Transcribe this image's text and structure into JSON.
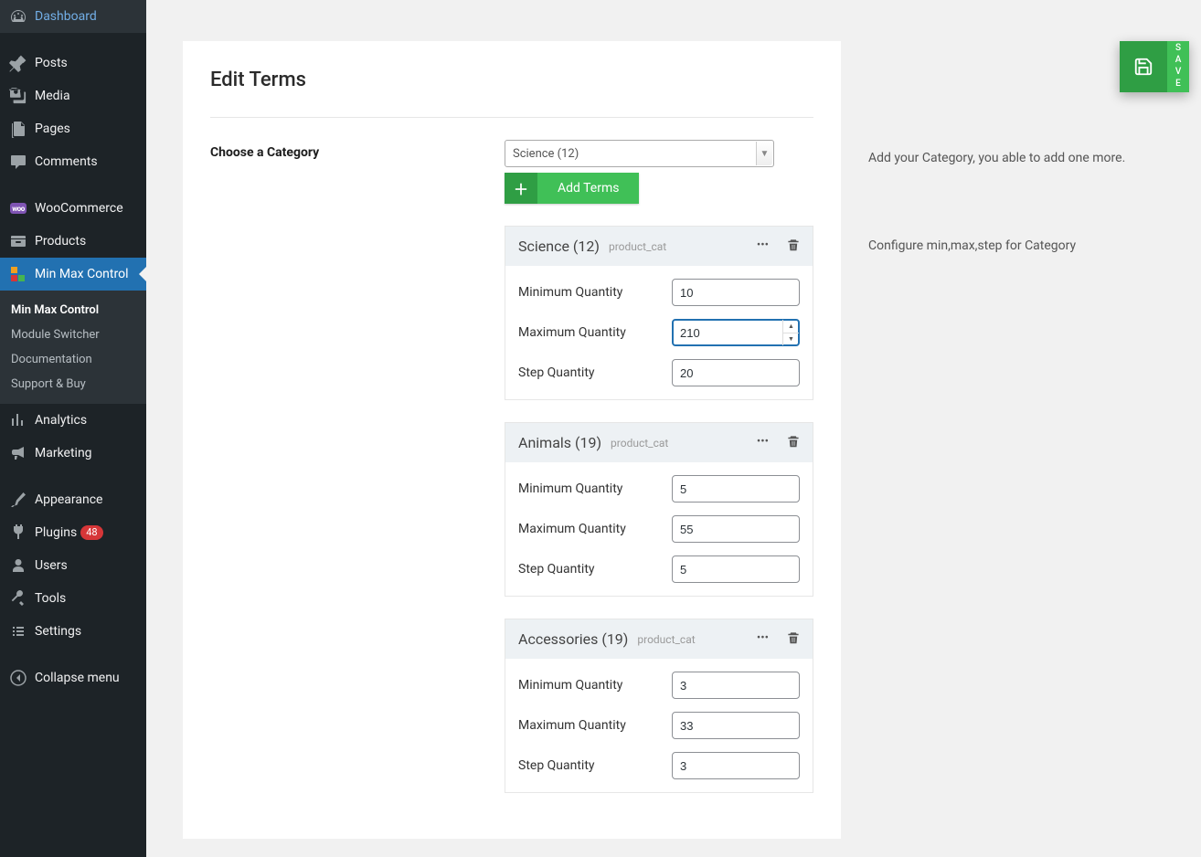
{
  "sidebar": {
    "items": [
      {
        "label": "Dashboard",
        "icon": "dashboard"
      },
      {
        "label": "Posts",
        "icon": "pin"
      },
      {
        "label": "Media",
        "icon": "media"
      },
      {
        "label": "Pages",
        "icon": "pages"
      },
      {
        "label": "Comments",
        "icon": "comment"
      },
      {
        "label": "WooCommerce",
        "icon": "woo"
      },
      {
        "label": "Products",
        "icon": "product"
      },
      {
        "label": "Min Max Control",
        "icon": "minmax",
        "current": true
      },
      {
        "label": "Analytics",
        "icon": "analytics"
      },
      {
        "label": "Marketing",
        "icon": "marketing"
      },
      {
        "label": "Appearance",
        "icon": "appearance"
      },
      {
        "label": "Plugins",
        "icon": "plugins",
        "badge": "48"
      },
      {
        "label": "Users",
        "icon": "users"
      },
      {
        "label": "Tools",
        "icon": "tools"
      },
      {
        "label": "Settings",
        "icon": "settings"
      },
      {
        "label": "Collapse menu",
        "icon": "collapse"
      }
    ],
    "submenu": [
      {
        "label": "Min Max Control",
        "current": true
      },
      {
        "label": "Module Switcher"
      },
      {
        "label": "Documentation"
      },
      {
        "label": "Support & Buy"
      }
    ]
  },
  "page": {
    "title": "Edit Terms",
    "choose_label": "Choose a Category",
    "select_value": "Science (12)",
    "add_terms_label": "Add Terms",
    "save_label": "SAVE"
  },
  "side_info": {
    "line1": "Add your Category, you able to add one more.",
    "line2": "Configure min,max,step for Category"
  },
  "labels": {
    "min": "Minimum Quantity",
    "max": "Maximum Quantity",
    "step": "Step Quantity"
  },
  "terms": [
    {
      "title": "Science (12)",
      "tax": "product_cat",
      "min": "10",
      "max": "210",
      "step": "20",
      "focused": "max"
    },
    {
      "title": "Animals (19)",
      "tax": "product_cat",
      "min": "5",
      "max": "55",
      "step": "5"
    },
    {
      "title": "Accessories (19)",
      "tax": "product_cat",
      "min": "3",
      "max": "33",
      "step": "3"
    }
  ]
}
